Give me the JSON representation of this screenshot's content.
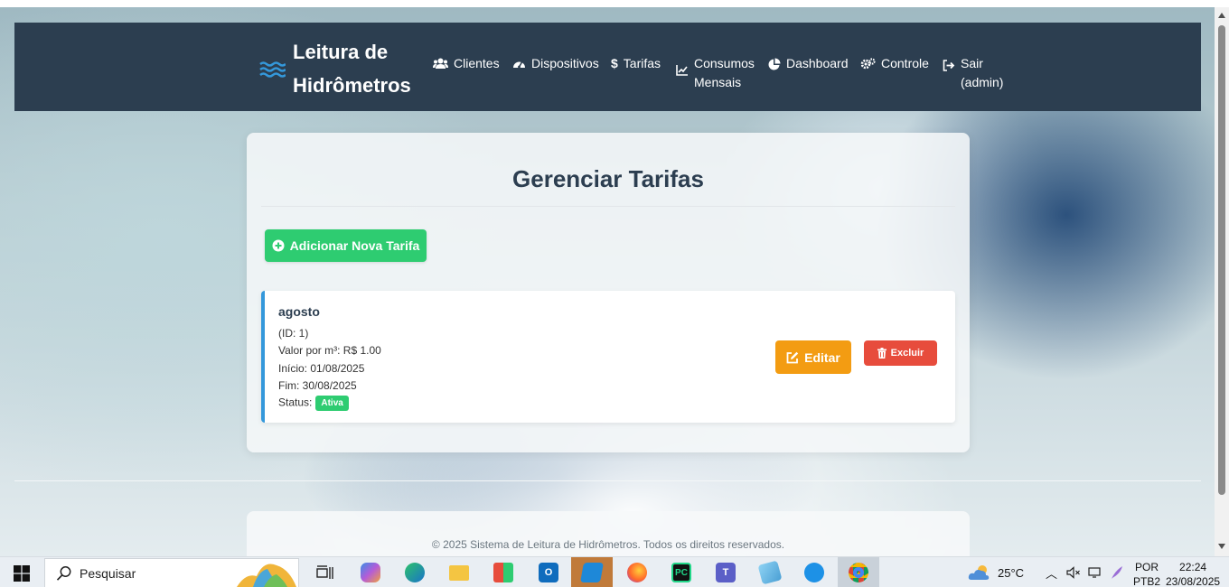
{
  "navbar": {
    "brand_line1": "Leitura de",
    "brand_line2": "Hidrômetros",
    "items": [
      {
        "label": "Clientes",
        "icon": "users-icon"
      },
      {
        "label": "Dispositivos",
        "icon": "gauge-icon"
      },
      {
        "label": "Tarifas",
        "icon": "dollar-icon"
      },
      {
        "label_line1": "Consumos",
        "label_line2": "Mensais",
        "icon": "chart-line-icon"
      },
      {
        "label": "Dashboard",
        "icon": "pie-chart-icon"
      },
      {
        "label": "Controle",
        "icon": "cogs-icon"
      },
      {
        "label_line1": "Sair",
        "label_line2": "(admin)",
        "icon": "sign-out-icon"
      }
    ]
  },
  "main": {
    "title": "Gerenciar Tarifas",
    "add_button_label": "Adicionar Nova Tarifa",
    "tariff": {
      "name": "agosto",
      "id_text": "(ID: 1)",
      "price_text": "Valor por m³: R$ 1.00",
      "start_text": "Início: 01/08/2025",
      "end_text": "Fim: 30/08/2025",
      "status_label": "Status:",
      "status_value": "Ativa",
      "edit_label": "Editar",
      "delete_label": "Excluir"
    }
  },
  "footer": {
    "text": "© 2025 Sistema de Leitura de Hidrômetros. Todos os direitos reservados."
  },
  "taskbar": {
    "search_placeholder": "Pesquisar",
    "weather": "25°C",
    "lang_line1": "POR",
    "lang_line2": "PTB2",
    "time": "22:24",
    "date": "23/08/2025"
  },
  "colors": {
    "navbar": "#2c3e50",
    "success": "#2ecc71",
    "warning": "#f39c12",
    "danger": "#e74c3c",
    "accent": "#3498db"
  }
}
